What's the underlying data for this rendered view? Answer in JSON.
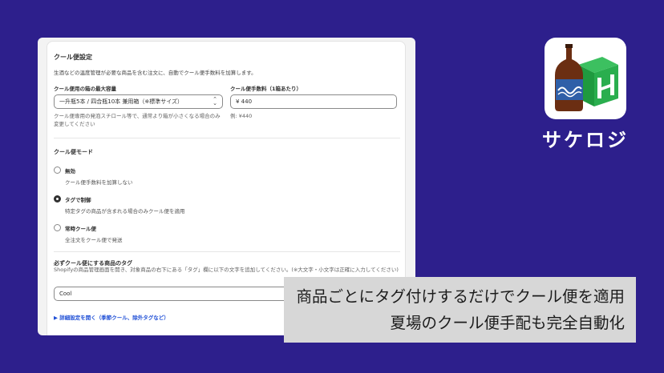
{
  "settings": {
    "cool_title": "クール便設定",
    "cool_desc": "生酒などの温度管理が必要な商品を含む注文に、自動でクール便手数料を加算します。",
    "box_label": "クール便用の箱の最大容量",
    "box_value": "一升瓶5本 / 四合瓶10本 兼用箱（※標準サイズ）",
    "box_help": "クール便専用の発泡スチロール等で、通常より箱が小さくなる場合のみ変更してください",
    "fee_label": "クール便手数料（1箱あたり）",
    "fee_value": "¥ 440",
    "fee_help": "例: ¥440",
    "mode_title": "クール便モード",
    "options": [
      {
        "title": "無効",
        "desc": "クール便手数料を加算しない",
        "selected": false
      },
      {
        "title": "タグで制御",
        "desc": "特定タグの商品が含まれる場合のみクール便を適用",
        "selected": true
      },
      {
        "title": "常時クール便",
        "desc": "全注文をクール便で発送",
        "selected": false
      }
    ],
    "tag_title": "必ずクール便にする商品のタグ",
    "tag_desc": "Shopifyの商品管理画面を開き、対象商品の右下にある「タグ」欄に以下の文字を追加してください。(※大文字・小文字は正確に入力してください)",
    "tag_value": "Cool",
    "advanced_link": "▶ 詳細設定を開く（季節クール、除外タグなど）"
  },
  "app": {
    "icon": "sake-bottle-and-box-icon",
    "name": "サケロジ"
  },
  "caption": {
    "line1": "商品ごとにタグ付けするだけでクール便を適用",
    "line2": "夏場のクール便手配も完全自動化"
  },
  "colors": {
    "background": "#2d1f8c",
    "bottle": "#6b2e12",
    "box": "#1f9a3f",
    "label": "#2f5fa8"
  }
}
